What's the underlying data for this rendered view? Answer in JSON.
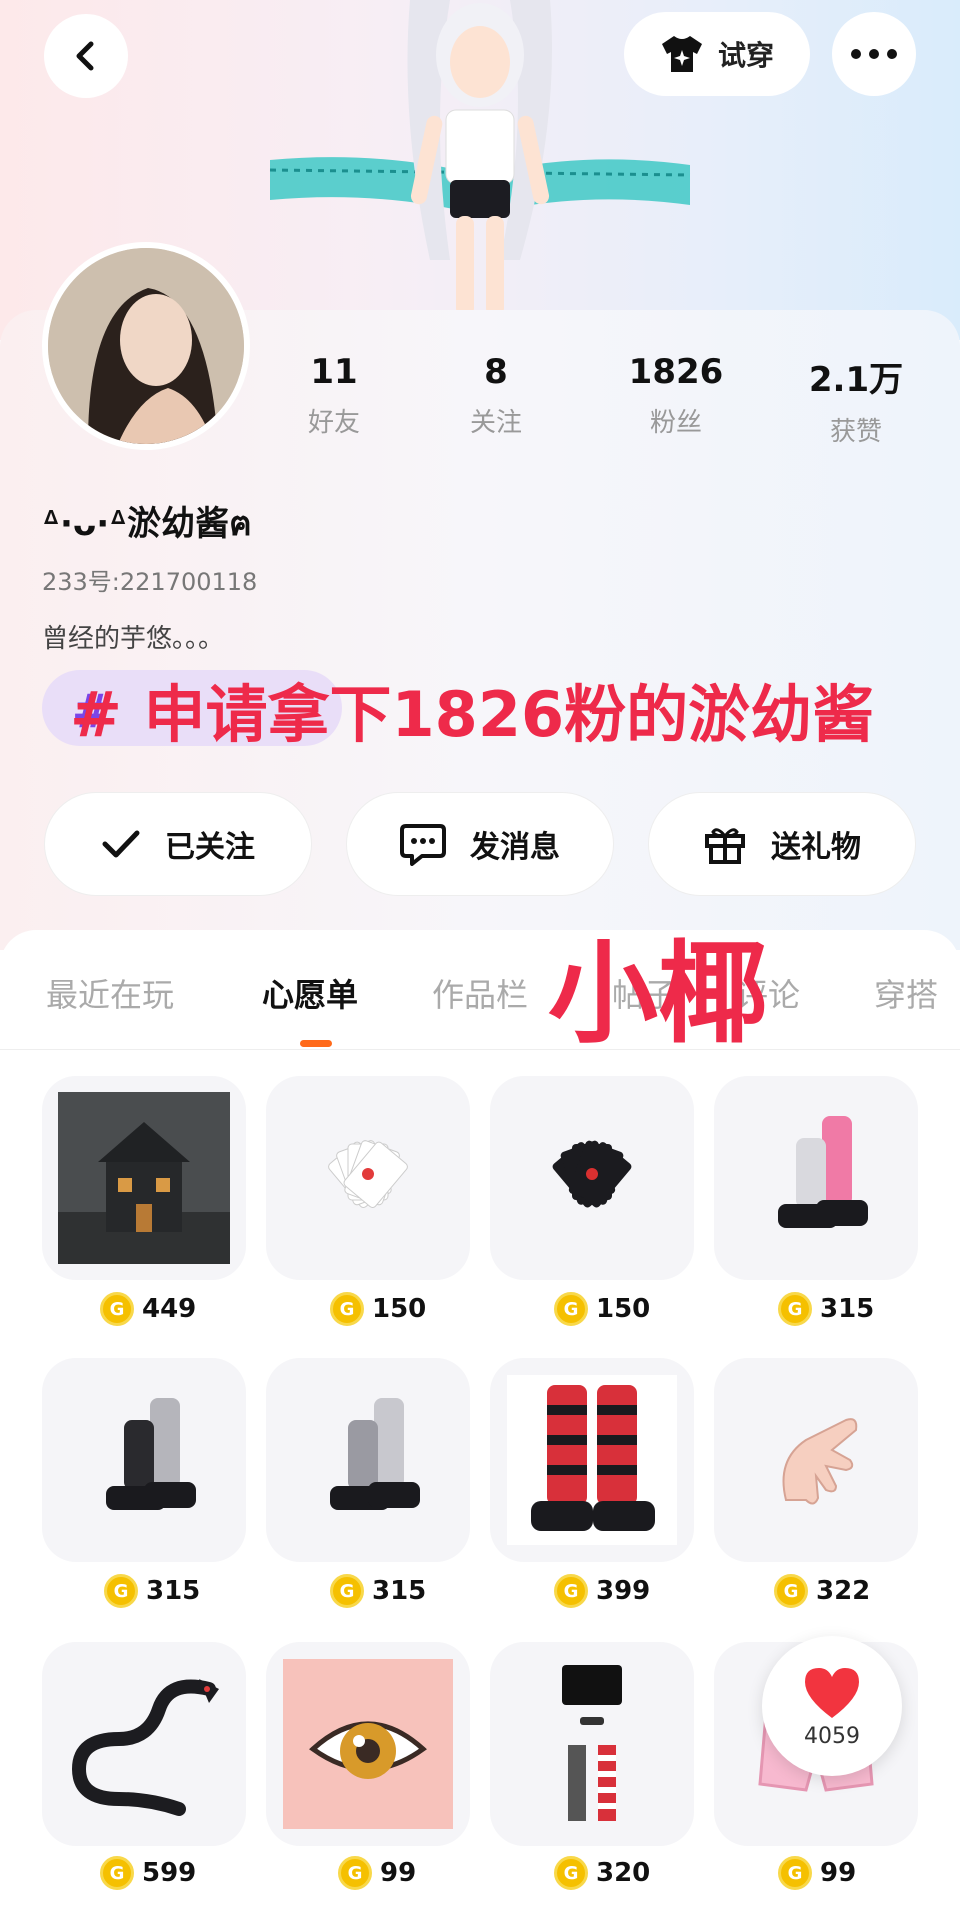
{
  "header": {
    "try_on_label": "试穿"
  },
  "profile": {
    "username": "ᐞ·ᴗ·ᐞ淤幼酱ฅ",
    "account_id": "233号:221700118",
    "bio": "曾经的芋悠。。。",
    "stats": [
      {
        "value": "11",
        "label": "好友"
      },
      {
        "value": "8",
        "label": "关注"
      },
      {
        "value": "1826",
        "label": "粉丝"
      },
      {
        "value": "2.1万",
        "label": "获赞"
      }
    ]
  },
  "overlay": {
    "headline": "# 申请拿下1826粉的淤幼酱",
    "watermark": "小椰"
  },
  "actions": {
    "follow_label": "已关注",
    "message_label": "发消息",
    "gift_label": "送礼物"
  },
  "tabs": [
    {
      "label": "最近在玩"
    },
    {
      "label": "心愿单"
    },
    {
      "label": "作品栏"
    },
    {
      "label": "帖子"
    },
    {
      "label": "评论"
    },
    {
      "label": "穿搭"
    }
  ],
  "active_tab": "心愿单",
  "wishlist": [
    {
      "price": "449",
      "icon": "haunted-house"
    },
    {
      "price": "150",
      "icon": "playing-cards-white"
    },
    {
      "price": "150",
      "icon": "playing-cards-black"
    },
    {
      "price": "315",
      "icon": "pink-leg-warmer-boots"
    },
    {
      "price": "315",
      "icon": "grey-leg-warmer-boots"
    },
    {
      "price": "315",
      "icon": "grey-leg-warmer-boots-2"
    },
    {
      "price": "399",
      "icon": "red-striped-boots"
    },
    {
      "price": "322",
      "icon": "hand-nails"
    },
    {
      "price": "599",
      "icon": "black-dragon"
    },
    {
      "price": "99",
      "icon": "anime-eye"
    },
    {
      "price": "320",
      "icon": "skirt-and-socks"
    },
    {
      "price": "99",
      "icon": "pink-shorts"
    }
  ],
  "like_float": {
    "count": "4059"
  },
  "colors": {
    "accent_orange": "#ff6a1a",
    "overlay_red": "#ee2a4a",
    "coin_gold": "#f5c000"
  }
}
